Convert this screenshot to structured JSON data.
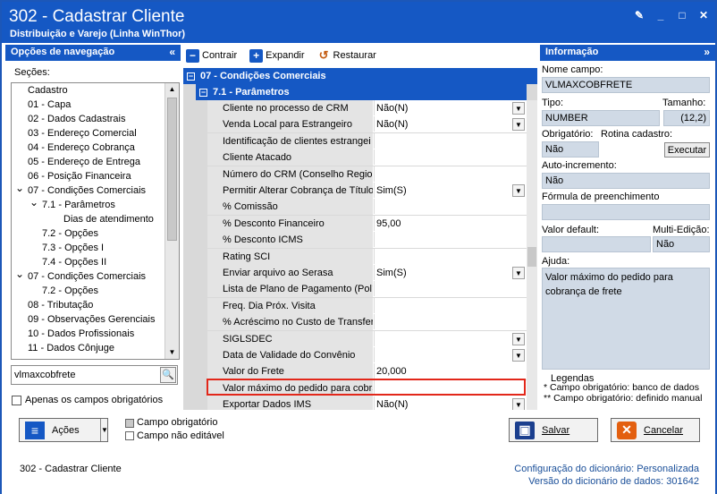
{
  "window": {
    "title": "302 - Cadastrar Cliente",
    "subtitle": "Distribuição e Varejo (Linha WinThor)"
  },
  "left": {
    "header": "Opções de navegação",
    "sections_label": "Seções:",
    "tree": [
      {
        "label": "Cadastro",
        "indent": 0,
        "toggle": ""
      },
      {
        "label": "01 - Capa",
        "indent": 0,
        "toggle": ""
      },
      {
        "label": "02 - Dados Cadastrais",
        "indent": 0,
        "toggle": ""
      },
      {
        "label": "03 - Endereço Comercial",
        "indent": 0,
        "toggle": ""
      },
      {
        "label": "04 - Endereço Cobrança",
        "indent": 0,
        "toggle": ""
      },
      {
        "label": "05 - Endereço de Entrega",
        "indent": 0,
        "toggle": ""
      },
      {
        "label": "06 - Posição Financeira",
        "indent": 0,
        "toggle": ""
      },
      {
        "label": "07 - Condições Comerciais",
        "indent": 0,
        "toggle": "v"
      },
      {
        "label": "7.1 - Parâmetros",
        "indent": 1,
        "toggle": "v"
      },
      {
        "label": "Dias de atendimento",
        "indent": 2,
        "toggle": ""
      },
      {
        "label": "7.2 - Opções",
        "indent": 1,
        "toggle": ""
      },
      {
        "label": "7.3 - Opções I",
        "indent": 1,
        "toggle": ""
      },
      {
        "label": "7.4 - Opções II",
        "indent": 1,
        "toggle": ""
      },
      {
        "label": "07 - Condições Comerciais",
        "indent": 0,
        "toggle": "v"
      },
      {
        "label": "7.2 - Opções",
        "indent": 1,
        "toggle": ""
      },
      {
        "label": "08 - Tributação",
        "indent": 0,
        "toggle": ""
      },
      {
        "label": "09 - Observações Gerenciais",
        "indent": 0,
        "toggle": ""
      },
      {
        "label": "10 - Dados Profissionais",
        "indent": 0,
        "toggle": ""
      },
      {
        "label": "11 - Dados Cônjuge",
        "indent": 0,
        "toggle": ""
      }
    ],
    "search_value": "vlmaxcobfrete",
    "only_required": "Apenas os campos obrigatórios"
  },
  "toolbar": {
    "collapse": "Contrair",
    "expand": "Expandir",
    "restore": "Restaurar"
  },
  "grid": {
    "group": "07 - Condições Comerciais",
    "subgroup": "7.1 - Parâmetros",
    "rows": [
      {
        "label": "Cliente no processo de CRM",
        "value": "Não(N)",
        "dropdown": true
      },
      {
        "label": "Venda Local para Estrangeiro",
        "value": "Não(N)",
        "dropdown": true
      },
      {
        "label": "Identificação de clientes estrangei",
        "value": "",
        "dropdown": false
      },
      {
        "label": "Cliente Atacado",
        "value": "",
        "dropdown": false
      },
      {
        "label": "Número do CRM (Conselho Region",
        "value": "",
        "dropdown": false
      },
      {
        "label": "Permitir Alterar Cobrança de Título",
        "value": "Sim(S)",
        "dropdown": true
      },
      {
        "label": "% Comissão",
        "value": "",
        "dropdown": false
      },
      {
        "label": "% Desconto Financeiro",
        "value": "95,00",
        "dropdown": false
      },
      {
        "label": "% Desconto ICMS",
        "value": "",
        "dropdown": false
      },
      {
        "label": "Rating SCI",
        "value": "",
        "dropdown": false
      },
      {
        "label": "Enviar arquivo ao Serasa",
        "value": "Sim(S)",
        "dropdown": true
      },
      {
        "label": "Lista de Plano de Pagamento (Polít",
        "value": "",
        "dropdown": false
      },
      {
        "label": "Freq. Dia Próx. Visita",
        "value": "",
        "dropdown": false
      },
      {
        "label": "% Acréscimo no Custo de Transfer",
        "value": "",
        "dropdown": false
      },
      {
        "label": "SIGLSDEC",
        "value": "",
        "dropdown": true
      },
      {
        "label": "Data de Validade do Convênio",
        "value": "",
        "dropdown": true
      },
      {
        "label": "Valor do Frete",
        "value": "20,000",
        "dropdown": false
      },
      {
        "label": "Valor máximo do pedido para cobra",
        "value": "",
        "dropdown": false
      },
      {
        "label": "Exportar Dados IMS",
        "value": "Não(N)",
        "dropdown": true
      }
    ]
  },
  "info": {
    "header": "Informação",
    "field_name_label": "Nome campo:",
    "field_name": "VLMAXCOBFRETE",
    "type_label": "Tipo:",
    "type": "NUMBER",
    "size_label": "Tamanho:",
    "size": "(12,2)",
    "required_label": "Obrigatório:",
    "routine_label": "Rotina cadastro:",
    "required": "Não",
    "execute": "Executar",
    "autoinc_label": "Auto-incremento:",
    "autoinc": "Não",
    "formula_label": "Fórmula de preenchimento",
    "default_label": "Valor default:",
    "multi_label": "Multi-Edição:",
    "multi": "Não",
    "help_label": "Ajuda:",
    "help": "Valor máximo do pedido para cobrança de frete",
    "legend_title": "Legendas",
    "legend1": "* Campo obrigatório: banco de dados",
    "legend2": "** Campo obrigatório: definido manual"
  },
  "bottom": {
    "actions": "Ações",
    "legend_required": "Campo obrigatório",
    "legend_noedit": "Campo não editável",
    "save": "Salvar",
    "cancel": "Cancelar",
    "footer_left": "302 - Cadastrar Cliente",
    "dict_config_label": "Configuração do dicionário:",
    "dict_config": "Personalizada",
    "dict_version_label": "Versão do dicionário de dados:",
    "dict_version": "301642"
  },
  "colors": {
    "accent": "#1558c4",
    "highlight": "#e2271a",
    "info_box": "#d0dae6"
  }
}
